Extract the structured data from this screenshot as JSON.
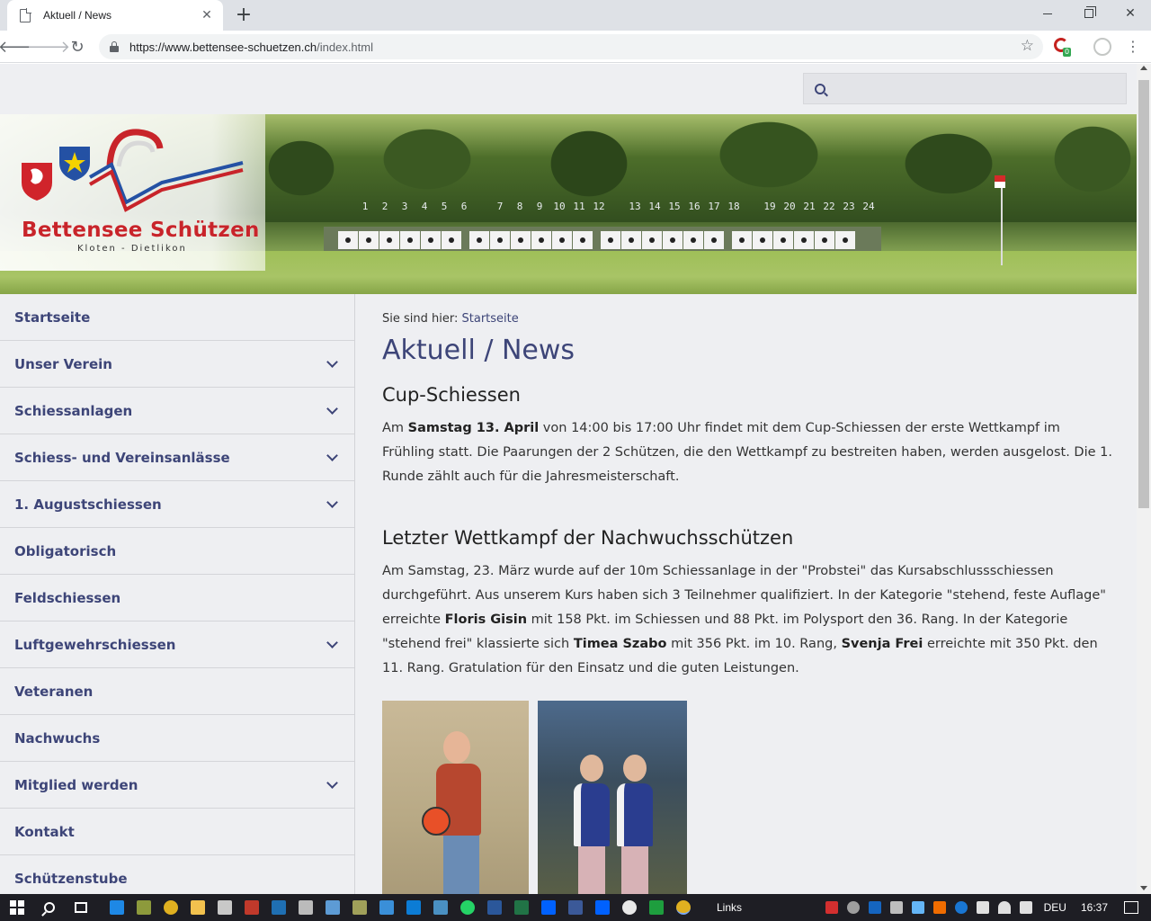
{
  "browser": {
    "tab_title": "Aktuell / News",
    "tab_close": "✕",
    "new_tab": "+",
    "url_host": "https://www.bettensee-schuetzen.ch",
    "url_path": "/index.html"
  },
  "site": {
    "logo_title": "Bettensee Schützen",
    "logo_subtitle": "Kloten - Dietlikon",
    "search_placeholder": "",
    "lane_numbers": [
      "1",
      "2",
      "3",
      "4",
      "5",
      "6",
      "7",
      "8",
      "9",
      "10",
      "11",
      "12",
      "13",
      "14",
      "15",
      "16",
      "17",
      "18",
      "19",
      "20",
      "21",
      "22",
      "23",
      "24"
    ]
  },
  "sidebar": {
    "items": [
      {
        "label": "Startseite",
        "expandable": false
      },
      {
        "label": "Unser Verein",
        "expandable": true
      },
      {
        "label": "Schiessanlagen",
        "expandable": true
      },
      {
        "label": "Schiess- und Vereinsanlässe",
        "expandable": true
      },
      {
        "label": "1. Augustschiessen",
        "expandable": true
      },
      {
        "label": "Obligatorisch",
        "expandable": false
      },
      {
        "label": "Feldschiessen",
        "expandable": false
      },
      {
        "label": "Luftgewehrschiessen",
        "expandable": true
      },
      {
        "label": "Veteranen",
        "expandable": false
      },
      {
        "label": "Nachwuchs",
        "expandable": false
      },
      {
        "label": "Mitglied werden",
        "expandable": true
      },
      {
        "label": "Kontakt",
        "expandable": false
      },
      {
        "label": "Schützenstube",
        "expandable": false
      }
    ]
  },
  "main": {
    "breadcrumb_prefix": "Sie sind hier:",
    "breadcrumb_link": "Startseite",
    "page_title": "Aktuell / News",
    "articles": [
      {
        "title": "Cup-Schiessen",
        "p_1": "Am ",
        "b_1": "Samstag 13. April",
        "p_2": " von 14:00 bis 17:00 Uhr findet mit dem Cup-Schiessen der erste Wettkampf im Frühling statt. Die Paarungen der 2 Schützen, die den Wettkampf zu bestreiten haben, werden ausgelost. Die 1. Runde zählt auch für die Jahresmeisterschaft."
      },
      {
        "title": "Letzter Wettkampf der Nachwuchsschützen",
        "p_1": "Am Samstag, 23. März wurde auf der 10m Schiessanlage in der \"Probstei\" das Kursabschlussschiessen durchgeführt. Aus unserem Kurs haben sich 3 Teilnehmer qualifiziert. In der Kategorie \"stehend, feste Auflage\" erreichte ",
        "b_1": "Floris Gisin",
        "p_2": " mit 158 Pkt. im Schiessen und 88 Pkt. im Polysport den 36. Rang. In der Kategorie \"stehend frei\" klassierte sich ",
        "b_2": "Timea Szabo",
        "p_3": " mit 356 Pkt. im 10. Rang, ",
        "b_3": "Svenja Frei",
        "p_4": " erreichte mit 350 Pkt. den 11. Rang. Gratulation für den Einsatz und die guten Leistungen."
      }
    ]
  },
  "taskbar": {
    "links_label": "Links",
    "language": "DEU",
    "time": "16:37"
  },
  "colors": {
    "accent": "#3d4578",
    "logo_red": "#c8242a",
    "page_bg": "#eeeff2"
  }
}
